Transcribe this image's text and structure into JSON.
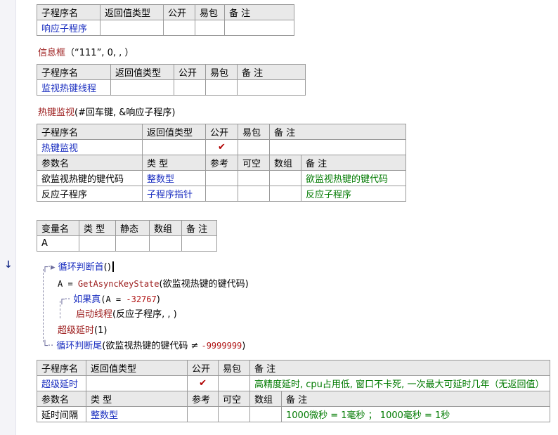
{
  "sub1": {
    "headers": [
      "子程序名",
      "返回值类型",
      "公开",
      "易包",
      "备 注"
    ],
    "name": "响应子程序"
  },
  "call1": {
    "func": "信息框",
    "args": "（“111”, 0, , ）"
  },
  "sub2": {
    "headers": [
      "子程序名",
      "返回值类型",
      "公开",
      "易包",
      "备 注"
    ],
    "name": "监视热键线程"
  },
  "call2": {
    "func": "热键监视",
    "args": "(#回车键, &响应子程序)"
  },
  "sub3": {
    "headers": [
      "子程序名",
      "返回值类型",
      "公开",
      "易包",
      "备 注"
    ],
    "name": "热键监视",
    "public_mark": "✔",
    "param_headers": [
      "参数名",
      "类 型",
      "参考",
      "可空",
      "数组",
      "备 注"
    ],
    "params": [
      {
        "name": "欲监视热键的键代码",
        "type": "整数型",
        "note": "欲监视热键的键代码"
      },
      {
        "name": "反应子程序",
        "type": "子程序指针",
        "note": "反应子程序"
      }
    ]
  },
  "vars": {
    "headers": [
      "变量名",
      "类 型",
      "静态",
      "数组",
      "备 注"
    ],
    "name": "A"
  },
  "code": {
    "arrow": "↓",
    "l1_kw": "循环判断首",
    "l1_args": "()",
    "l2_lhs": "A = ",
    "l2_fn": "GetAsyncKeyState",
    "l2_args": "(欲监视热键的键代码)",
    "l3_kw": "如果真",
    "l3_open": "(A = ",
    "l3_num": "-32767",
    "l3_close": ")",
    "l4_kw": "启动线程",
    "l4_args": "(反应子程序, , )",
    "l5_kw": "超级延时",
    "l5_args": "(1)",
    "l6_kw": "循环判断尾",
    "l6_args": "(欲监视热键的键代码 ≠ ",
    "l6_num": "-9999999",
    "l6_close": ")"
  },
  "sub4": {
    "headers": [
      "子程序名",
      "返回值类型",
      "公开",
      "易包",
      "备 注"
    ],
    "name": "超级延时",
    "public_mark": "✔",
    "note": "高精度延时, cpu占用低, 窗口不卡死, 一次最大可延时几年（无返回值）",
    "param_headers": [
      "参数名",
      "类 型",
      "参考",
      "可空",
      "数组",
      "备 注"
    ],
    "param": {
      "name": "延时间隔",
      "type": "整数型",
      "note": "1000微秒 = 1毫秒 ； 1000毫秒 = 1秒"
    }
  }
}
